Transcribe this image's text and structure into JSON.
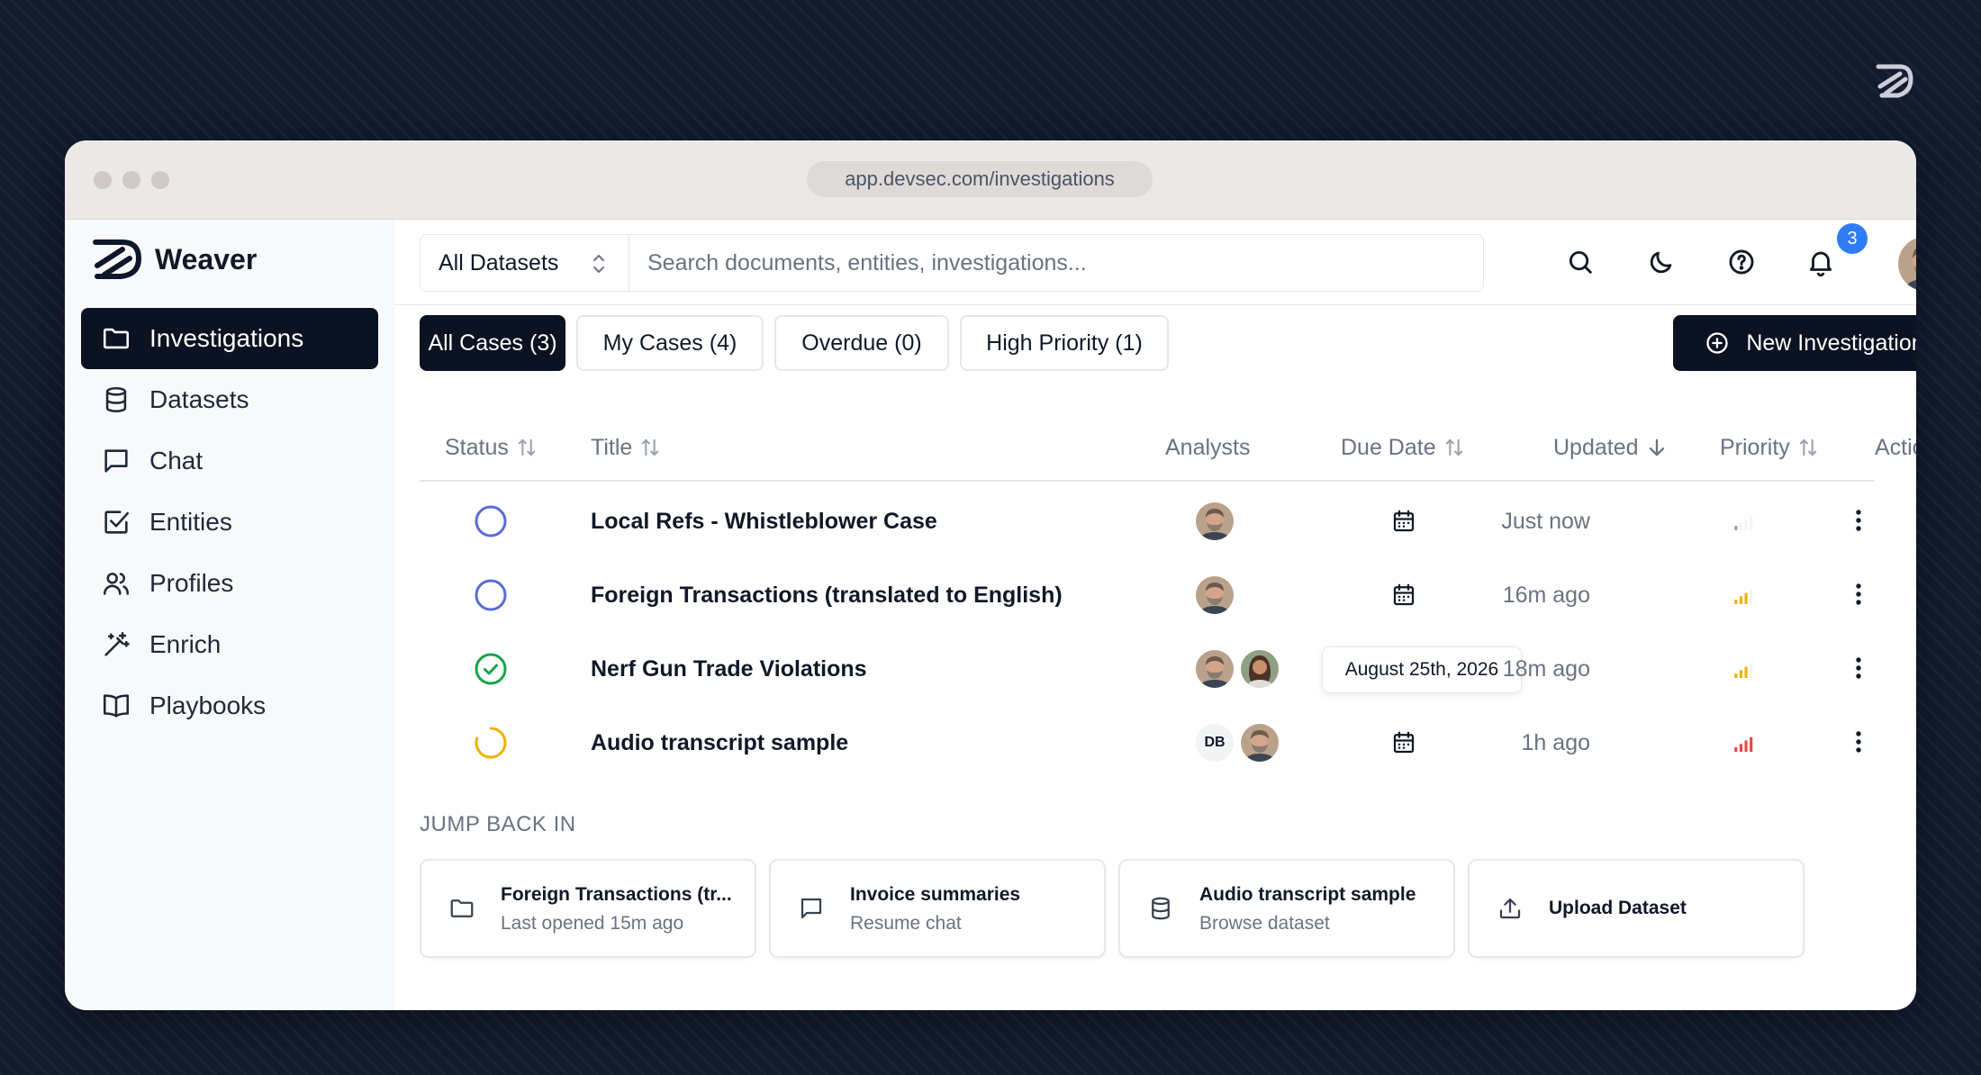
{
  "browser": {
    "url": "app.devsec.com/investigations"
  },
  "brand": {
    "name": "Weaver"
  },
  "sidebar": {
    "items": [
      {
        "label": "Investigations",
        "icon": "folder-icon",
        "active": true
      },
      {
        "label": "Datasets",
        "icon": "database-icon"
      },
      {
        "label": "Chat",
        "icon": "chat-icon"
      },
      {
        "label": "Entities",
        "icon": "check-square-icon"
      },
      {
        "label": "Profiles",
        "icon": "users-icon"
      },
      {
        "label": "Enrich",
        "icon": "magic-wand-icon"
      },
      {
        "label": "Playbooks",
        "icon": "book-icon"
      }
    ]
  },
  "topbar": {
    "dataset_select": "All Datasets",
    "search_placeholder": "Search documents, entities, investigations...",
    "notification_count": "3"
  },
  "tabs": [
    {
      "label": "All Cases (3)",
      "active": true
    },
    {
      "label": "My Cases (4)"
    },
    {
      "label": "Overdue (0)"
    },
    {
      "label": "High Priority (1)"
    }
  ],
  "new_button": {
    "label": "New Investigation"
  },
  "table": {
    "headers": {
      "status": "Status",
      "title": "Title",
      "analysts": "Analysts",
      "due": "Due Date",
      "updated": "Updated",
      "priority": "Priority",
      "actions": "Actions"
    },
    "rows": [
      {
        "status": "open",
        "title": "Local Refs - Whistleblower Case",
        "analysts": [
          "bearded-man-avatar"
        ],
        "due": "",
        "updated": "Just now",
        "priority": 1
      },
      {
        "status": "open",
        "title": "Foreign Transactions (translated to English)",
        "analysts": [
          "bearded-man-avatar"
        ],
        "due": "",
        "updated": "16m ago",
        "priority": 3
      },
      {
        "status": "complete",
        "title": "Nerf Gun Trade Violations",
        "analysts": [
          "bearded-man-avatar",
          "woman-avatar"
        ],
        "due": "August 25th, 2026",
        "updated": "18m ago",
        "priority": 3
      },
      {
        "status": "in-progress",
        "title": "Audio transcript sample",
        "analysts": [
          "DB",
          "bearded-man-avatar"
        ],
        "due": "",
        "updated": "1h ago",
        "priority": 4
      }
    ]
  },
  "jump_back": {
    "title": "JUMP BACK IN",
    "cards": [
      {
        "title": "Foreign Transactions (tr...",
        "subtitle": "Last opened 15m ago",
        "icon": "folder-icon"
      },
      {
        "title": "Invoice summaries",
        "subtitle": "Resume chat",
        "icon": "chat-icon"
      },
      {
        "title": "Audio transcript sample",
        "subtitle": "Browse dataset",
        "icon": "database-icon"
      },
      {
        "title": "Upload Dataset",
        "subtitle": "",
        "icon": "upload-icon"
      }
    ]
  },
  "colors": {
    "dark": "#0b1221",
    "status_open": "#5b6bd6",
    "status_complete": "#16a34a",
    "status_progress": "#eab308",
    "priority_medium": "#eab308",
    "priority_high": "#ef4444",
    "badge": "#2f7cf6"
  }
}
